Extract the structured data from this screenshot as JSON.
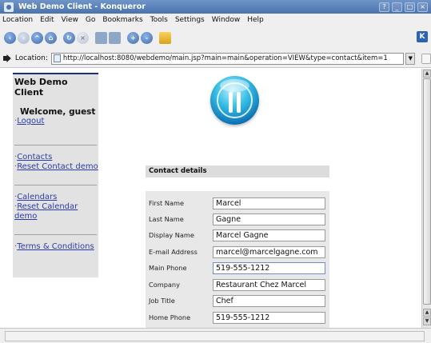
{
  "window": {
    "title": "Web Demo Client - Konqueror",
    "buttons": [
      "?",
      "_",
      "□",
      "×"
    ]
  },
  "menu": [
    "Location",
    "Edit",
    "View",
    "Go",
    "Bookmarks",
    "Tools",
    "Settings",
    "Window",
    "Help"
  ],
  "toolbar": {
    "icons": [
      "back-icon",
      "forward-icon",
      "up-icon",
      "home-icon",
      "reload-icon",
      "stop-icon",
      "print-icon",
      "find-icon",
      "zoom-in-icon",
      "zoom-out-icon",
      "security-lock-icon"
    ]
  },
  "location": {
    "label": "Location:",
    "url": "http://localhost:8080/webdemo/main.jsp?main=main&operation=VIEW&type=contact&item=1"
  },
  "sidebar": {
    "title": "Web Demo Client",
    "welcome": "Welcome, guest",
    "bullet": "·",
    "links": {
      "logout": "Logout",
      "contacts": "Contacts",
      "reset_contact": "Reset Contact demo",
      "calendars": "Calendars",
      "reset_calendar": "Reset Calendar demo",
      "terms": "Terms & Conditions"
    }
  },
  "form": {
    "title": "Contact details",
    "fields": [
      {
        "label": "First Name",
        "value": "Marcel"
      },
      {
        "label": "Last Name",
        "value": "Gagne"
      },
      {
        "label": "Display Name",
        "value": "Marcel Gagne"
      },
      {
        "label": "E-mail Address",
        "value": "marcel@marcelgagne.com"
      },
      {
        "label": "Main Phone",
        "value": "519-555-1212"
      },
      {
        "label": "Company",
        "value": "Restaurant Chez Marcel"
      },
      {
        "label": "Job Title",
        "value": "Chef"
      },
      {
        "label": "Home Phone",
        "value": "519-555-1212"
      }
    ]
  }
}
